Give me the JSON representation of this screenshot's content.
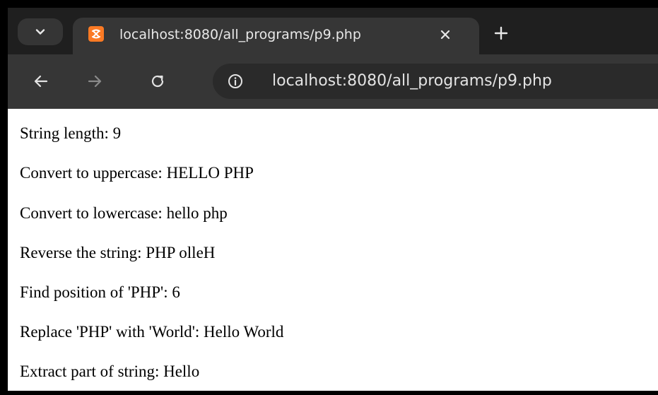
{
  "browser": {
    "tab": {
      "title": "localhost:8080/all_programs/p9.php"
    },
    "address_bar": {
      "url": "localhost:8080/all_programs/p9.php"
    },
    "icons": {
      "tab_search": "chevron-down-icon",
      "favicon": "xampp-icon",
      "close": "close-icon",
      "new_tab": "plus-icon",
      "back": "arrow-left-icon",
      "forward": "arrow-right-icon",
      "reload": "reload-icon",
      "site_info": "info-icon"
    }
  },
  "page": {
    "lines": [
      "String length: 9",
      "Convert to uppercase: HELLO PHP",
      "Convert to lowercase: hello php",
      "Reverse the string: PHP olleH",
      "Find position of 'PHP': 6",
      "Replace 'PHP' with 'World': Hello World",
      "Extract part of string: Hello"
    ]
  },
  "colors": {
    "tabstrip_bg": "#1f1f1f",
    "toolbar_bg": "#363636",
    "favicon_orange": "#fb7a24",
    "page_bg": "#ffffff"
  }
}
